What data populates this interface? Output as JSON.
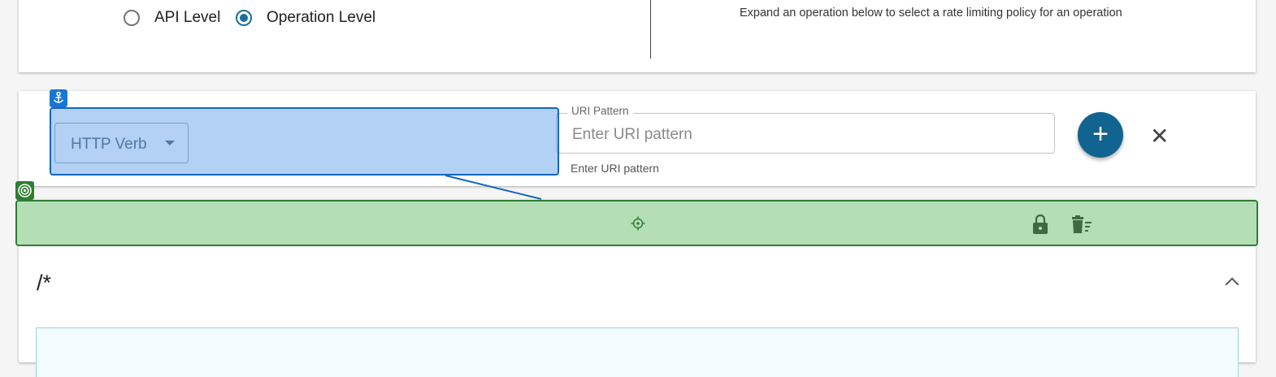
{
  "rate_limit": {
    "options": [
      {
        "label": "API Level",
        "selected": false
      },
      {
        "label": "Operation Level",
        "selected": true
      }
    ],
    "info_line": "Expand an operation below to select a rate limiting policy for an operation"
  },
  "operation_form": {
    "http_verb_label": "HTTP Verb",
    "uri_legend": "URI Pattern",
    "uri_placeholder": "Enter URI pattern",
    "uri_value": "",
    "uri_helper": "Enter URI pattern",
    "add_label": "+",
    "close_label": "✕"
  },
  "overlays": {
    "colors": {
      "blue": "#1565c0",
      "green": "#2e7d32"
    },
    "blue_tag_icon": "anchor-icon",
    "green_tag_icon": "target-icon",
    "center_icon": "crosshair-icon",
    "action_icons": [
      "lock-icon",
      "delete-sweep-icon"
    ]
  },
  "operation": {
    "path": "/*"
  }
}
